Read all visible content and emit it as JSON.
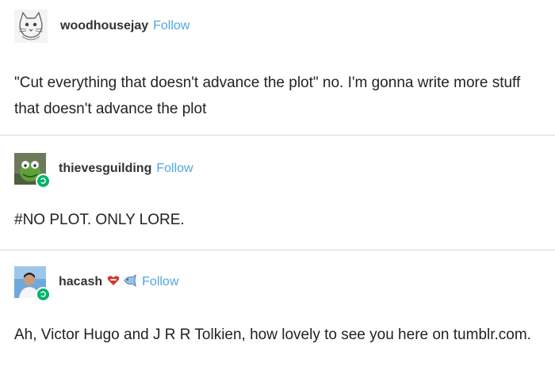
{
  "posts": [
    {
      "username": "woodhousejay",
      "follow_label": "Follow",
      "avatar_icon": "drawn-cat-avatar-icon",
      "text": "\"Cut everything that doesn't advance the plot\" no. I'm gonna write more stuff that doesn't advance the plot"
    },
    {
      "username": "thievesguilding",
      "follow_label": "Follow",
      "avatar_icon": "kermit-avatar-icon",
      "text": "#NO PLOT. ONLY LORE."
    },
    {
      "username": "hacash",
      "follow_label": "Follow",
      "avatar_icon": "person-avatar-icon",
      "badges": [
        "red-heart-badge-icon",
        "blue-fish-badge-icon"
      ],
      "text": "Ah, Victor Hugo and J R R Tolkien, how lovely to see you here on tumblr.com."
    }
  ],
  "colors": {
    "follow": "#4fa6e0",
    "online_badge": "#00b36b",
    "divider": "#d8d8d8"
  }
}
